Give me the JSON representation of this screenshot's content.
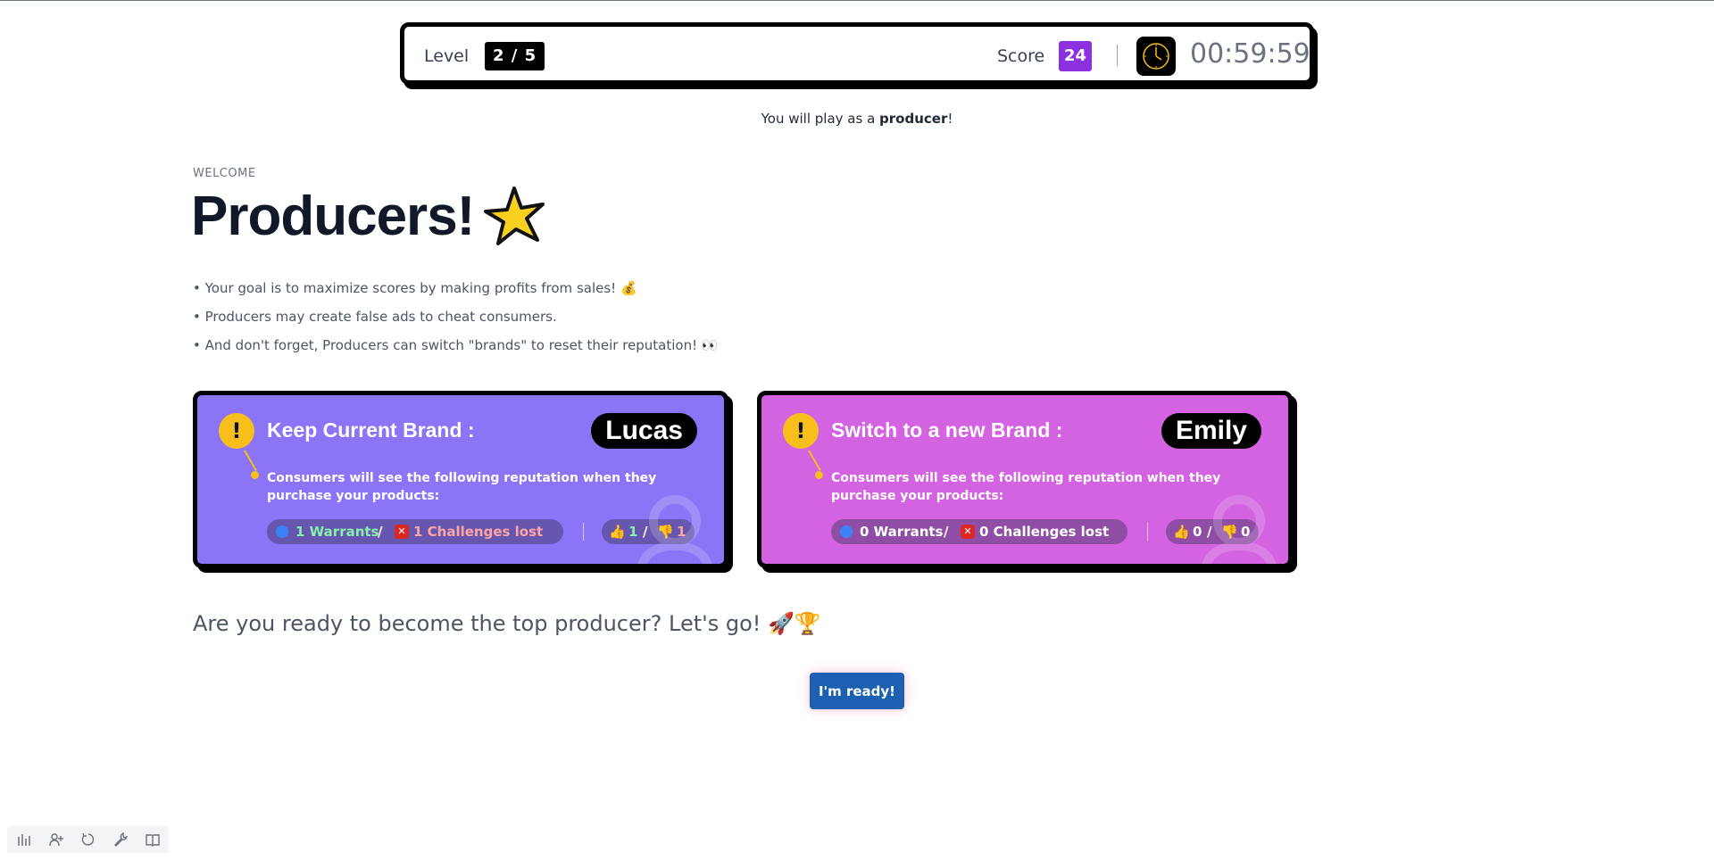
{
  "header": {
    "level_label": "Level",
    "level_value": "2 / 5",
    "score_label": "Score",
    "score_value": "24",
    "timer": "00:59:59",
    "clock_icon": "stopwatch-icon"
  },
  "role": {
    "prefix": "You will play as a ",
    "role": "producer",
    "suffix": "!"
  },
  "intro": {
    "eyebrow": "WELCOME",
    "title": "Producers!",
    "title_icon": "star-icon",
    "bullets": [
      "• Your goal is to maximize scores by making profits from sales! 💰",
      "• Producers may create false ads to cheat consumers.",
      "• And don't forget, Producers can switch \"brands\" to reset their reputation! 👀"
    ]
  },
  "cards": [
    {
      "title": "Keep Current Brand :",
      "brand": "Lucas",
      "desc": "Consumers will see the following reputation when they purchase your products:",
      "warrants": "1 Warrants",
      "slash": "/",
      "challenges": "1 Challenges lost",
      "likes": "1",
      "dislikes": "1",
      "color": "#8b74f5"
    },
    {
      "title": "Switch to a new Brand :",
      "brand": "Emily",
      "desc": "Consumers will see the following reputation when they purchase your products:",
      "warrants": "0 Warrants",
      "slash": "/",
      "challenges": "0 Challenges lost",
      "likes": "0",
      "dislikes": "0",
      "color": "#d463e2"
    }
  ],
  "closing": {
    "question": "Are you ready to become the top producer? Let's go! 🚀🏆",
    "button": "I'm ready!"
  },
  "dock": [
    "chart-icon",
    "add-user-icon",
    "refresh-icon",
    "wrench-icon",
    "book-icon"
  ]
}
